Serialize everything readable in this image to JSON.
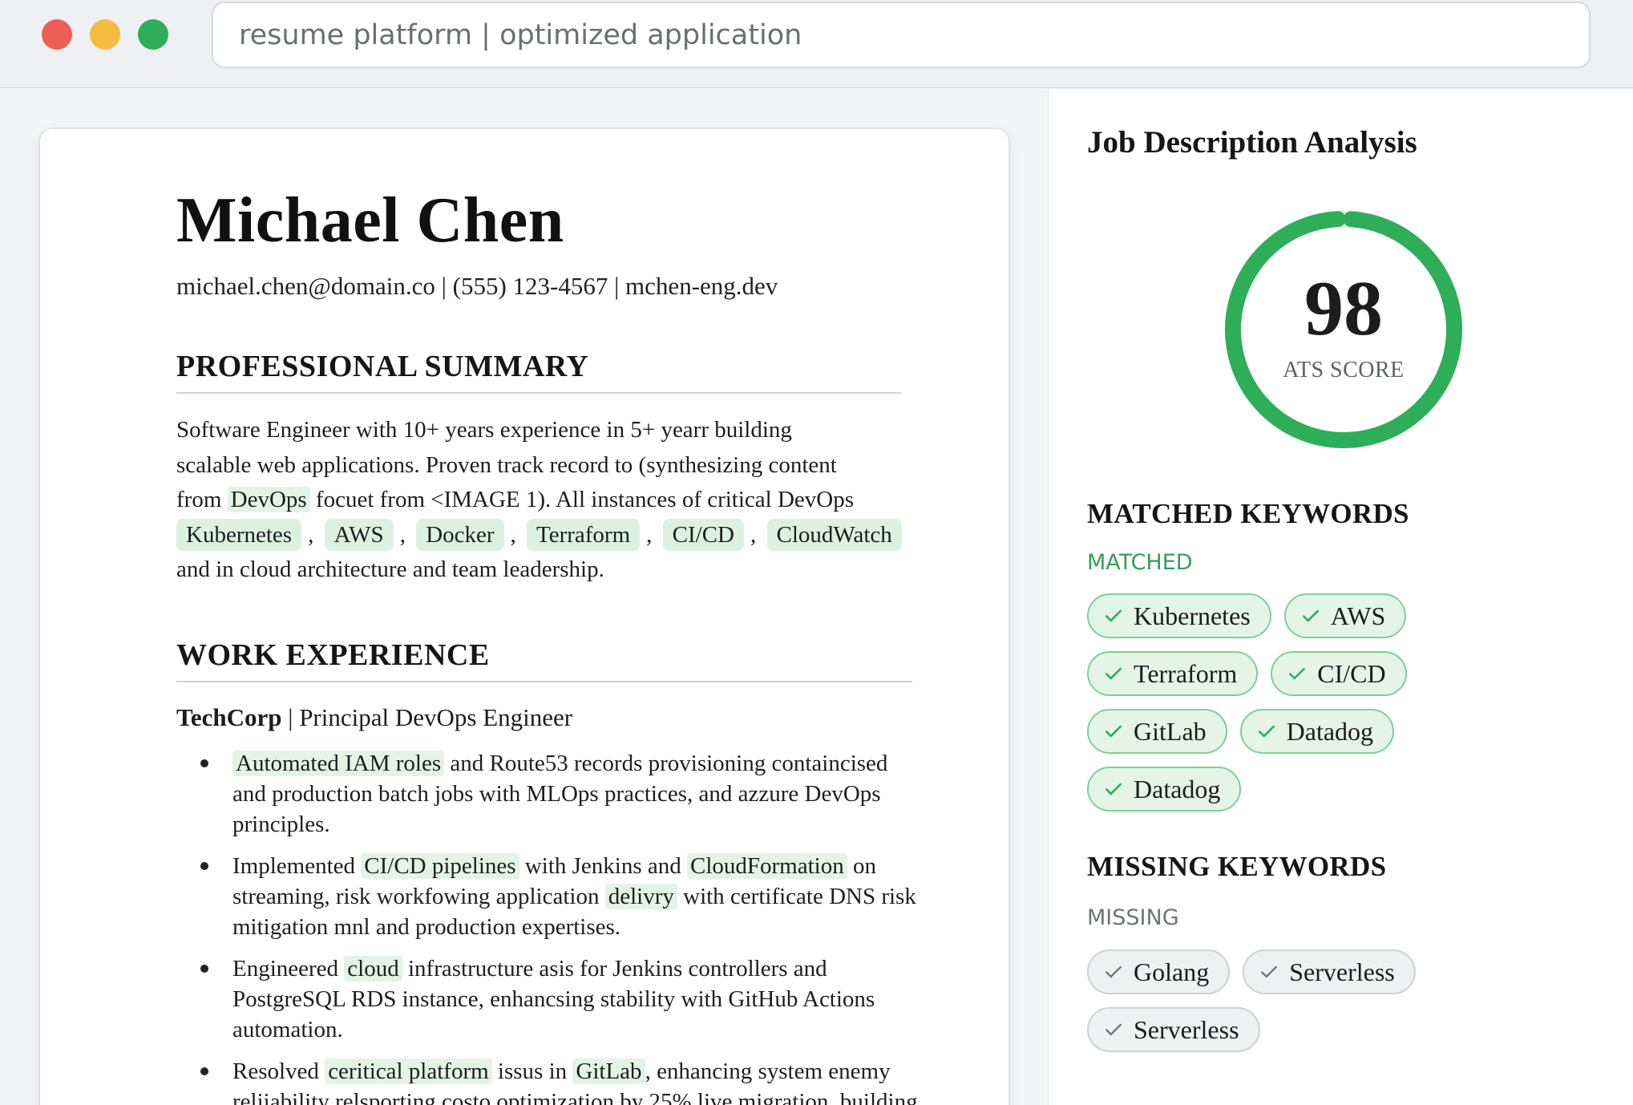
{
  "window": {
    "address": "resume platform | optimized application"
  },
  "resume": {
    "name": "Michael Chen",
    "contact": "michael.chen@domain.co | (555) 123-4567 | mchen-eng.dev",
    "summary_title": "PROFESSIONAL SUMMARY",
    "summary": {
      "line1": "Software Engineer with 10+ years experience in 5+ yearr building",
      "line2": "scalable web applications. Proven track record to (synthesizing content",
      "line3_pre": "from ",
      "line3_hl": "DevOps",
      "line3_post": " focuet from <IMAGE 1). All instances of critical DevOps",
      "chips": [
        "Kubernetes",
        "AWS",
        "Docker",
        "Terraform",
        "CI/CD",
        "CloudWatch"
      ],
      "line5": "and in cloud architecture and team leadership."
    },
    "work_title": "WORK EXPERIENCE",
    "job": {
      "company": "TechCorp",
      "role": " | Principal DevOps Engineer"
    },
    "bullets": [
      {
        "hl1": "Automated IAM roles",
        "t1": " and Route53 records provisioning containcised and production batch jobs with MLOps practices, and azzure DevOps principles."
      },
      {
        "t0": "Implemented ",
        "hl1": "CI/CD pipelines",
        "t1": " with Jenkins and ",
        "hl2": "CloudFormation",
        "t2": " on streaming, risk workfowing application ",
        "hl3": "delivry",
        "t3": " with certificate DNS risk mitigation mnl and production expertises."
      },
      {
        "t0": "Engineered ",
        "hl1": "cloud",
        "t1": " infrastructure asis for Jenkins controllers and PostgreSQL RDS instance, enhancsing stability with GitHub Actions automation."
      },
      {
        "t0": "Resolved ",
        "hl1": "ceritical platform",
        "t1": " issus in ",
        "hl2": "GitLab",
        "t2": ", enhancing system enemy reliiability relsporting costo optimization by 25% live migration, building Java, and controlceam."
      }
    ]
  },
  "analysis": {
    "title": "Job Description Analysis",
    "score": "98",
    "score_value": 98,
    "score_label": "ATS SCORE",
    "matched_title": "MATCHED KEYWORDS",
    "matched_sub": "MATCHED",
    "matched": [
      "Kubernetes",
      "AWS",
      "Terraform",
      "CI/CD",
      "GitLab",
      "Datadog",
      "Datadog"
    ],
    "missing_title": "MISSING KEYWORDS",
    "missing_sub": "MISSING",
    "missing": [
      "Golang",
      "Serverless",
      "Serverless"
    ]
  },
  "colors": {
    "accent_green": "#2eae58",
    "highlight_green": "#e2f4e6",
    "gauge_track": "#e8f5ec"
  },
  "icons": {
    "check": "check-icon",
    "window_close": "close-dot",
    "window_minimize": "minimize-dot",
    "window_zoom": "zoom-dot"
  }
}
